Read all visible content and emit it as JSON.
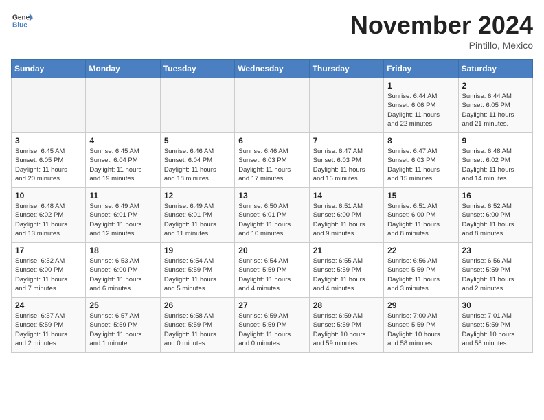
{
  "header": {
    "logo_general": "General",
    "logo_blue": "Blue",
    "title": "November 2024",
    "subtitle": "Pintillo, Mexico"
  },
  "weekdays": [
    "Sunday",
    "Monday",
    "Tuesday",
    "Wednesday",
    "Thursday",
    "Friday",
    "Saturday"
  ],
  "weeks": [
    [
      {
        "day": "",
        "info": ""
      },
      {
        "day": "",
        "info": ""
      },
      {
        "day": "",
        "info": ""
      },
      {
        "day": "",
        "info": ""
      },
      {
        "day": "",
        "info": ""
      },
      {
        "day": "1",
        "info": "Sunrise: 6:44 AM\nSunset: 6:06 PM\nDaylight: 11 hours\nand 22 minutes."
      },
      {
        "day": "2",
        "info": "Sunrise: 6:44 AM\nSunset: 6:05 PM\nDaylight: 11 hours\nand 21 minutes."
      }
    ],
    [
      {
        "day": "3",
        "info": "Sunrise: 6:45 AM\nSunset: 6:05 PM\nDaylight: 11 hours\nand 20 minutes."
      },
      {
        "day": "4",
        "info": "Sunrise: 6:45 AM\nSunset: 6:04 PM\nDaylight: 11 hours\nand 19 minutes."
      },
      {
        "day": "5",
        "info": "Sunrise: 6:46 AM\nSunset: 6:04 PM\nDaylight: 11 hours\nand 18 minutes."
      },
      {
        "day": "6",
        "info": "Sunrise: 6:46 AM\nSunset: 6:03 PM\nDaylight: 11 hours\nand 17 minutes."
      },
      {
        "day": "7",
        "info": "Sunrise: 6:47 AM\nSunset: 6:03 PM\nDaylight: 11 hours\nand 16 minutes."
      },
      {
        "day": "8",
        "info": "Sunrise: 6:47 AM\nSunset: 6:03 PM\nDaylight: 11 hours\nand 15 minutes."
      },
      {
        "day": "9",
        "info": "Sunrise: 6:48 AM\nSunset: 6:02 PM\nDaylight: 11 hours\nand 14 minutes."
      }
    ],
    [
      {
        "day": "10",
        "info": "Sunrise: 6:48 AM\nSunset: 6:02 PM\nDaylight: 11 hours\nand 13 minutes."
      },
      {
        "day": "11",
        "info": "Sunrise: 6:49 AM\nSunset: 6:01 PM\nDaylight: 11 hours\nand 12 minutes."
      },
      {
        "day": "12",
        "info": "Sunrise: 6:49 AM\nSunset: 6:01 PM\nDaylight: 11 hours\nand 11 minutes."
      },
      {
        "day": "13",
        "info": "Sunrise: 6:50 AM\nSunset: 6:01 PM\nDaylight: 11 hours\nand 10 minutes."
      },
      {
        "day": "14",
        "info": "Sunrise: 6:51 AM\nSunset: 6:00 PM\nDaylight: 11 hours\nand 9 minutes."
      },
      {
        "day": "15",
        "info": "Sunrise: 6:51 AM\nSunset: 6:00 PM\nDaylight: 11 hours\nand 8 minutes."
      },
      {
        "day": "16",
        "info": "Sunrise: 6:52 AM\nSunset: 6:00 PM\nDaylight: 11 hours\nand 8 minutes."
      }
    ],
    [
      {
        "day": "17",
        "info": "Sunrise: 6:52 AM\nSunset: 6:00 PM\nDaylight: 11 hours\nand 7 minutes."
      },
      {
        "day": "18",
        "info": "Sunrise: 6:53 AM\nSunset: 6:00 PM\nDaylight: 11 hours\nand 6 minutes."
      },
      {
        "day": "19",
        "info": "Sunrise: 6:54 AM\nSunset: 5:59 PM\nDaylight: 11 hours\nand 5 minutes."
      },
      {
        "day": "20",
        "info": "Sunrise: 6:54 AM\nSunset: 5:59 PM\nDaylight: 11 hours\nand 4 minutes."
      },
      {
        "day": "21",
        "info": "Sunrise: 6:55 AM\nSunset: 5:59 PM\nDaylight: 11 hours\nand 4 minutes."
      },
      {
        "day": "22",
        "info": "Sunrise: 6:56 AM\nSunset: 5:59 PM\nDaylight: 11 hours\nand 3 minutes."
      },
      {
        "day": "23",
        "info": "Sunrise: 6:56 AM\nSunset: 5:59 PM\nDaylight: 11 hours\nand 2 minutes."
      }
    ],
    [
      {
        "day": "24",
        "info": "Sunrise: 6:57 AM\nSunset: 5:59 PM\nDaylight: 11 hours\nand 2 minutes."
      },
      {
        "day": "25",
        "info": "Sunrise: 6:57 AM\nSunset: 5:59 PM\nDaylight: 11 hours\nand 1 minute."
      },
      {
        "day": "26",
        "info": "Sunrise: 6:58 AM\nSunset: 5:59 PM\nDaylight: 11 hours\nand 0 minutes."
      },
      {
        "day": "27",
        "info": "Sunrise: 6:59 AM\nSunset: 5:59 PM\nDaylight: 11 hours\nand 0 minutes."
      },
      {
        "day": "28",
        "info": "Sunrise: 6:59 AM\nSunset: 5:59 PM\nDaylight: 10 hours\nand 59 minutes."
      },
      {
        "day": "29",
        "info": "Sunrise: 7:00 AM\nSunset: 5:59 PM\nDaylight: 10 hours\nand 58 minutes."
      },
      {
        "day": "30",
        "info": "Sunrise: 7:01 AM\nSunset: 5:59 PM\nDaylight: 10 hours\nand 58 minutes."
      }
    ]
  ]
}
